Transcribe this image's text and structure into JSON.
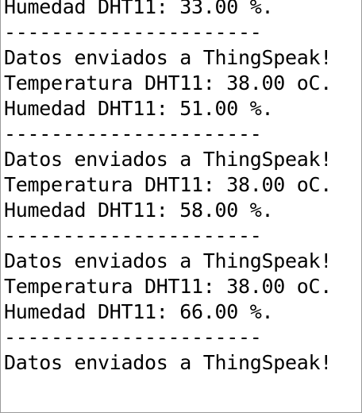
{
  "serial_monitor": {
    "lines": [
      "Humedad DHT11: 33.00 %.",
      "----------------------",
      "Datos enviados a ThingSpeak!",
      "Temperatura DHT11: 38.00 oC.",
      "Humedad DHT11: 51.00 %.",
      "----------------------",
      "Datos enviados a ThingSpeak!",
      "Temperatura DHT11: 38.00 oC.",
      "Humedad DHT11: 58.00 %.",
      "----------------------",
      "Datos enviados a ThingSpeak!",
      "Temperatura DHT11: 38.00 oC.",
      "Humedad DHT11: 66.00 %.",
      "----------------------",
      "Datos enviados a ThingSpeak!"
    ]
  }
}
